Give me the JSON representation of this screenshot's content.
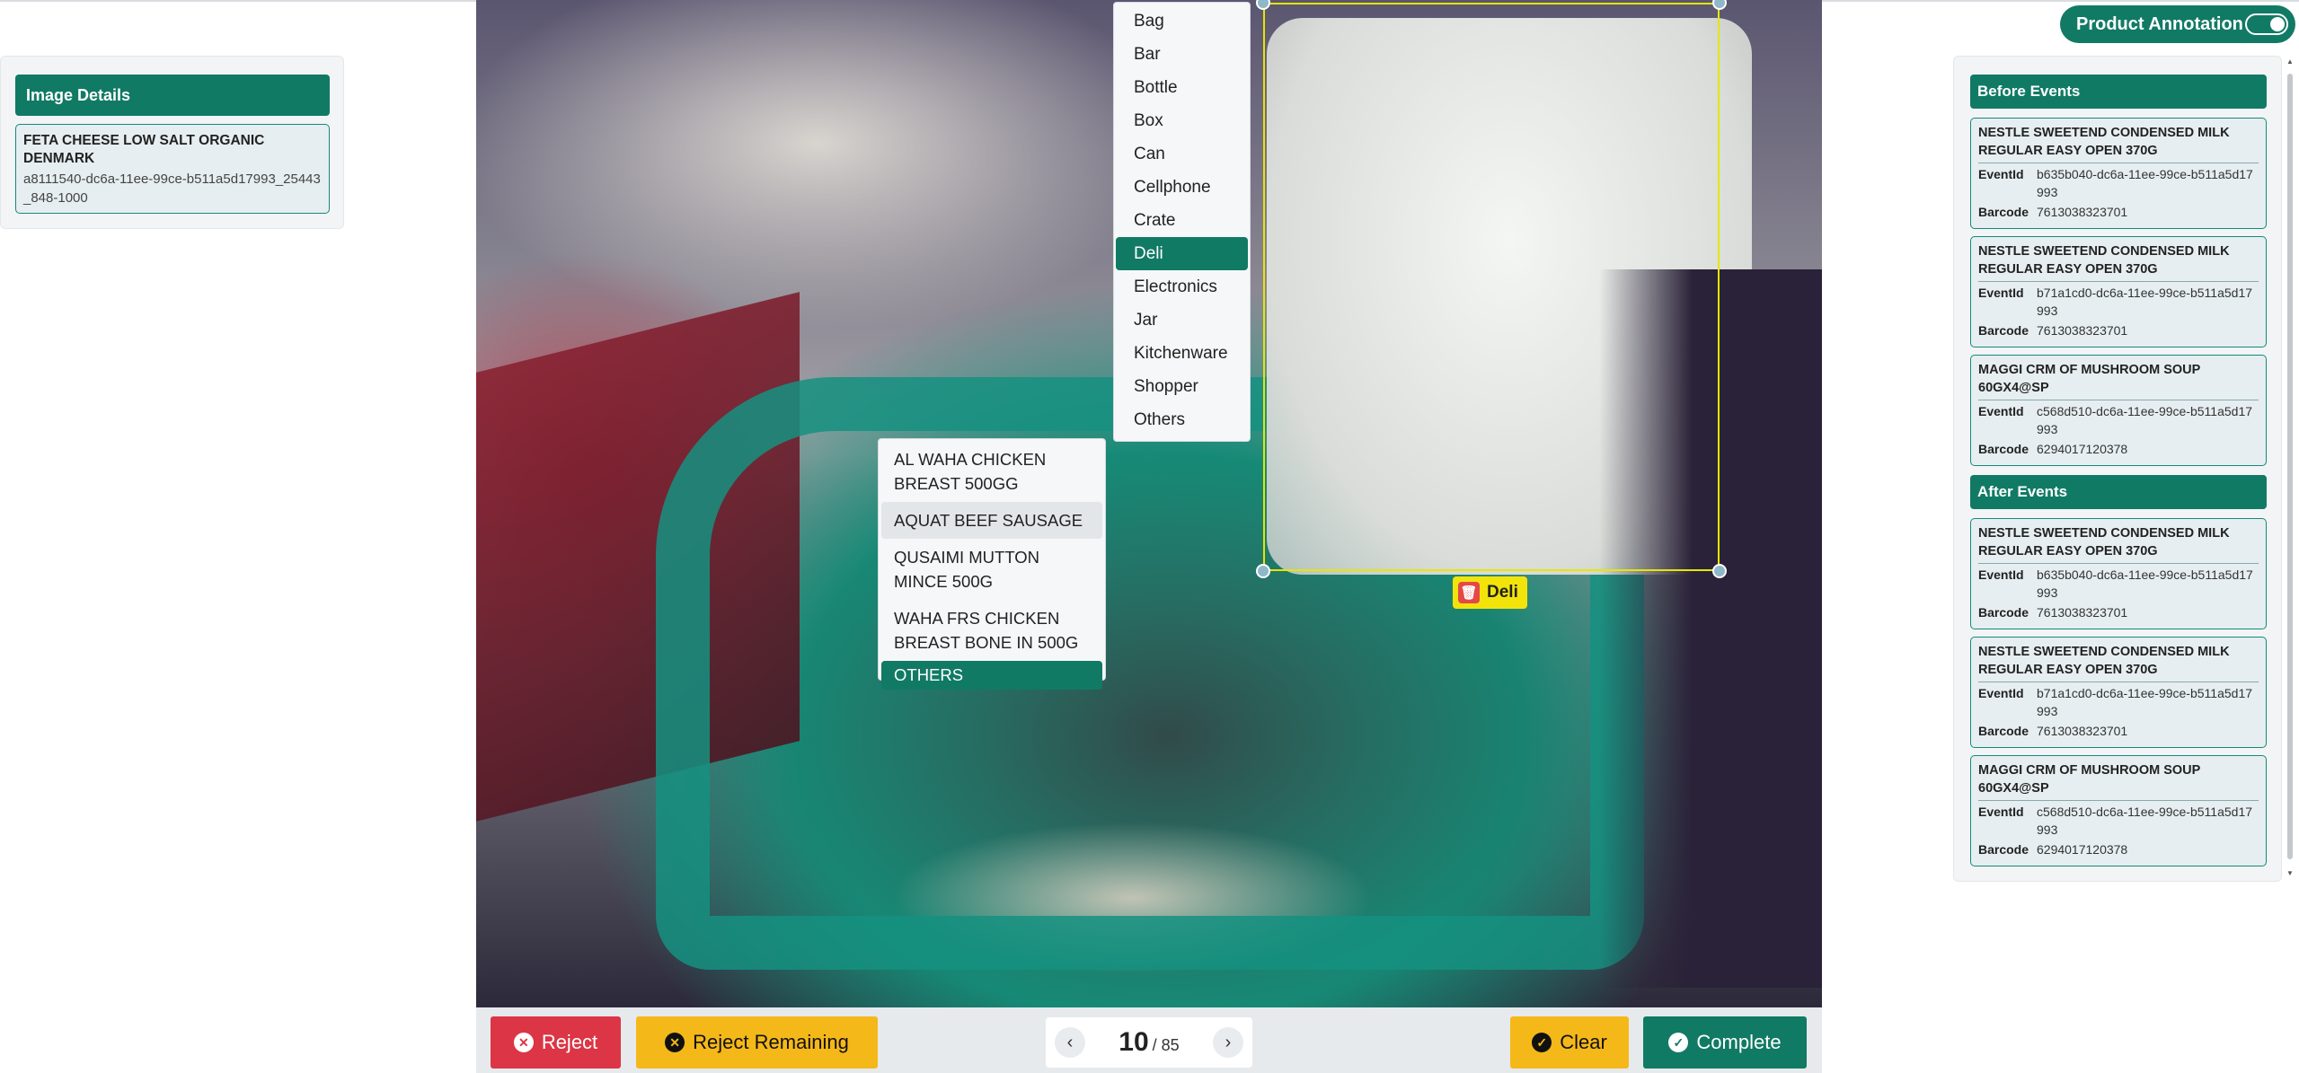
{
  "image_details": {
    "header": "Image Details",
    "product_name": "FETA CHEESE LOW SALT ORGANIC DENMARK",
    "image_id": "a8111540-dc6a-11ee-99ce-b511a5d17993_25443_848-1000"
  },
  "toggle": {
    "label": "Product Annotation",
    "on": true
  },
  "annotation": {
    "tag_label": "Deli"
  },
  "category_menu": {
    "items": [
      "Bag",
      "Bar",
      "Bottle",
      "Box",
      "Can",
      "Cellphone",
      "Crate",
      "Deli",
      "Electronics",
      "Jar",
      "Kitchenware",
      "Shopper",
      "Others"
    ],
    "selected": "Deli"
  },
  "product_menu": {
    "items": [
      "AL WAHA CHICKEN BREAST 500GG",
      "AQUAT BEEF SAUSAGE",
      "QUSAIMI MUTTON MINCE 500G",
      "WAHA FRS CHICKEN BREAST BONE IN 500G",
      "OTHERS"
    ],
    "hovered": "AQUAT BEEF SAUSAGE",
    "selected": "OTHERS"
  },
  "toolbar": {
    "reject": "Reject",
    "reject_remaining": "Reject Remaining",
    "clear": "Clear",
    "complete": "Complete"
  },
  "pager": {
    "current": "10",
    "total": "/ 85"
  },
  "before_events": {
    "header": "Before Events",
    "items": [
      {
        "name": "NESTLE SWEETEND CONDENSED MILK REGULAR EASY OPEN 370G",
        "event_id": "b635b040-dc6a-11ee-99ce-b511a5d17993",
        "barcode": "7613038323701"
      },
      {
        "name": "NESTLE SWEETEND CONDENSED MILK REGULAR EASY OPEN 370G",
        "event_id": "b71a1cd0-dc6a-11ee-99ce-b511a5d17993",
        "barcode": "7613038323701"
      },
      {
        "name": "MAGGI CRM OF MUSHROOM SOUP 60GX4@SP",
        "event_id": "c568d510-dc6a-11ee-99ce-b511a5d17993",
        "barcode": "6294017120378"
      }
    ]
  },
  "after_events": {
    "header": "After Events",
    "items": [
      {
        "name": "NESTLE SWEETEND CONDENSED MILK REGULAR EASY OPEN 370G",
        "event_id": "b635b040-dc6a-11ee-99ce-b511a5d17993",
        "barcode": "7613038323701"
      },
      {
        "name": "NESTLE SWEETEND CONDENSED MILK REGULAR EASY OPEN 370G",
        "event_id": "b71a1cd0-dc6a-11ee-99ce-b511a5d17993",
        "barcode": "7613038323701"
      },
      {
        "name": "MAGGI CRM OF MUSHROOM SOUP 60GX4@SP",
        "event_id": "c568d510-dc6a-11ee-99ce-b511a5d17993",
        "barcode": "6294017120378"
      }
    ]
  },
  "field_labels": {
    "event_id": "EventId",
    "barcode": "Barcode"
  },
  "colors": {
    "primary": "#117a65",
    "danger": "#dc3545",
    "warning": "#f5b819",
    "bbox": "#e6e600"
  },
  "icons": {
    "reject": "x-circle-icon",
    "clear": "check-circle-icon",
    "complete": "check-circle-icon",
    "tag_delete": "trash-icon",
    "prev": "chevron-left-icon",
    "next": "chevron-right-icon"
  }
}
